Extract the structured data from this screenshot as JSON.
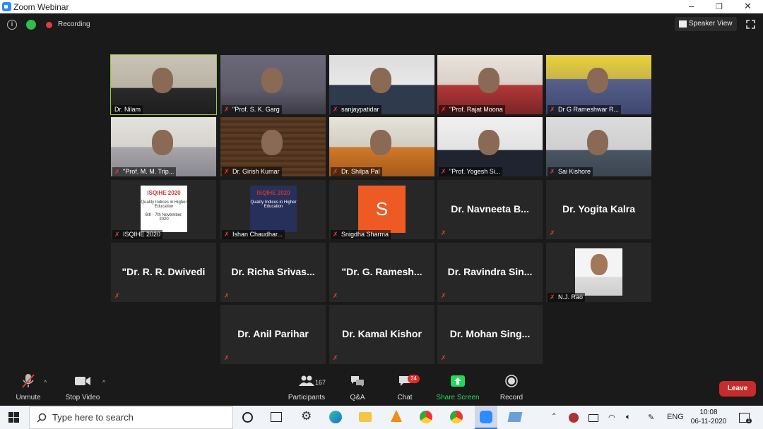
{
  "window": {
    "title": "Zoom Webinar",
    "minimize": "–",
    "restore": "❐",
    "close": "✕"
  },
  "topbar": {
    "recording_label": "Recording",
    "speaker_view_label": "Speaker View"
  },
  "colors": {
    "highlight": "#9acd32",
    "mute_red": "#e23b3b",
    "leave": "#c72c2c",
    "share_green": "#23d959",
    "badge_red": "#e02828"
  },
  "participants": [
    {
      "name": "Dr. Nilam",
      "type": "video"
    },
    {
      "name": "\"Prof. S. K. Garg",
      "type": "video"
    },
    {
      "name": "sanjaypatidar",
      "type": "video"
    },
    {
      "name": "\"Prof. Rajat Moona",
      "type": "video"
    },
    {
      "name": "Dr G Rameshwar R...",
      "type": "video"
    },
    {
      "name": "\"Prof. M. M. Trip...",
      "type": "video"
    },
    {
      "name": "Dr. Girish Kumar",
      "type": "video"
    },
    {
      "name": "Dr. Shilpa Pal",
      "type": "video"
    },
    {
      "name": "\"Prof. Yogesh Si...",
      "type": "video"
    },
    {
      "name": "Sai Kishore",
      "type": "video"
    },
    {
      "name": "ISQIHE 2020",
      "type": "image",
      "poster_title": "ISQIHE 2020",
      "poster_line": "Quality Indices in Higher Education",
      "poster_dates": "6th - 7th November, 2020"
    },
    {
      "name": "Ishan Chaudhar...",
      "type": "image",
      "poster_title": "ISQIHE 2020",
      "poster_line": "Quality Indices in Higher Education"
    },
    {
      "name": "Snigdha Sharma",
      "type": "avatar",
      "initial": "S"
    },
    {
      "name": "Dr. Navneeta B...",
      "type": "name"
    },
    {
      "name": "Dr. Yogita Kalra",
      "type": "name"
    },
    {
      "name": "\"Dr. R. R. Dwivedi",
      "type": "name"
    },
    {
      "name": "Dr. Richa Srivas...",
      "type": "name"
    },
    {
      "name": "\"Dr. G. Ramesh...",
      "type": "name"
    },
    {
      "name": "Dr. Ravindra Sin...",
      "type": "name"
    },
    {
      "name": "N.J. Rao",
      "type": "photo"
    },
    {
      "name": "Dr. Anil Parihar",
      "type": "name"
    },
    {
      "name": "Dr. Kamal Kishor",
      "type": "name"
    },
    {
      "name": "Dr. Mohan Sing...",
      "type": "name"
    }
  ],
  "toolbar": {
    "unmute": "Unmute",
    "stop_video": "Stop Video",
    "participants": "Participants",
    "participant_count": "167",
    "qa": "Q&A",
    "chat": "Chat",
    "chat_badge": "24",
    "share_screen": "Share Screen",
    "record": "Record",
    "leave": "Leave"
  },
  "taskbar": {
    "search_placeholder": "Type here to search",
    "lang": "ENG",
    "time": "10:08",
    "date": "06-11-2020",
    "notif_count": "1"
  }
}
